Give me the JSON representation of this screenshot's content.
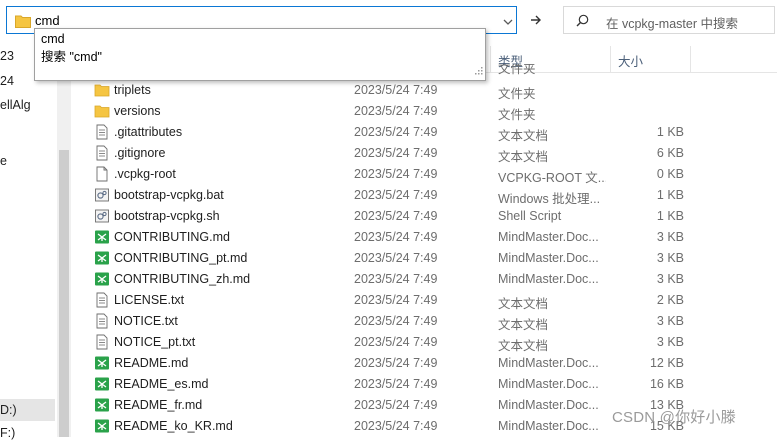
{
  "address_bar": {
    "value": "cmd"
  },
  "search_box": {
    "placeholder": "在 vcpkg-master 中搜索"
  },
  "autocomplete": {
    "items": [
      "cmd",
      "搜索 \"cmd\""
    ]
  },
  "nav_pane": {
    "items": [
      "23",
      "24",
      "ellAlg",
      "e",
      "D:)",
      "F:)"
    ]
  },
  "columns": {
    "type": "类型",
    "size": "大小"
  },
  "partial_row": {
    "type": "文件夹"
  },
  "files": [
    {
      "name": "triplets",
      "date": "2023/5/24 7:49",
      "type": "文件夹",
      "size": "",
      "icon": "folder-icon"
    },
    {
      "name": "versions",
      "date": "2023/5/24 7:49",
      "type": "文件夹",
      "size": "",
      "icon": "folder-icon"
    },
    {
      "name": ".gitattributes",
      "date": "2023/5/24 7:49",
      "type": "文本文档",
      "size": "1 KB",
      "icon": "text-file-icon"
    },
    {
      "name": ".gitignore",
      "date": "2023/5/24 7:49",
      "type": "文本文档",
      "size": "6 KB",
      "icon": "text-file-icon"
    },
    {
      "name": ".vcpkg-root",
      "date": "2023/5/24 7:49",
      "type": "VCPKG-ROOT 文...",
      "size": "0 KB",
      "icon": "blank-file-icon"
    },
    {
      "name": "bootstrap-vcpkg.bat",
      "date": "2023/5/24 7:49",
      "type": "Windows 批处理...",
      "size": "1 KB",
      "icon": "script-file-icon"
    },
    {
      "name": "bootstrap-vcpkg.sh",
      "date": "2023/5/24 7:49",
      "type": "Shell Script",
      "size": "1 KB",
      "icon": "script-file-icon"
    },
    {
      "name": "CONTRIBUTING.md",
      "date": "2023/5/24 7:49",
      "type": "MindMaster.Doc...",
      "size": "3 KB",
      "icon": "mindmaster-file-icon"
    },
    {
      "name": "CONTRIBUTING_pt.md",
      "date": "2023/5/24 7:49",
      "type": "MindMaster.Doc...",
      "size": "3 KB",
      "icon": "mindmaster-file-icon"
    },
    {
      "name": "CONTRIBUTING_zh.md",
      "date": "2023/5/24 7:49",
      "type": "MindMaster.Doc...",
      "size": "3 KB",
      "icon": "mindmaster-file-icon"
    },
    {
      "name": "LICENSE.txt",
      "date": "2023/5/24 7:49",
      "type": "文本文档",
      "size": "2 KB",
      "icon": "text-file-icon"
    },
    {
      "name": "NOTICE.txt",
      "date": "2023/5/24 7:49",
      "type": "文本文档",
      "size": "3 KB",
      "icon": "text-file-icon"
    },
    {
      "name": "NOTICE_pt.txt",
      "date": "2023/5/24 7:49",
      "type": "文本文档",
      "size": "3 KB",
      "icon": "text-file-icon"
    },
    {
      "name": "README.md",
      "date": "2023/5/24 7:49",
      "type": "MindMaster.Doc...",
      "size": "12 KB",
      "icon": "mindmaster-file-icon"
    },
    {
      "name": "README_es.md",
      "date": "2023/5/24 7:49",
      "type": "MindMaster.Doc...",
      "size": "16 KB",
      "icon": "mindmaster-file-icon"
    },
    {
      "name": "README_fr.md",
      "date": "2023/5/24 7:49",
      "type": "MindMaster.Doc...",
      "size": "13 KB",
      "icon": "mindmaster-file-icon"
    },
    {
      "name": "README_ko_KR.md",
      "date": "2023/5/24 7:49",
      "type": "MindMaster.Doc...",
      "size": "15 KB",
      "icon": "mindmaster-file-icon"
    }
  ],
  "watermark": "CSDN @你好小滕",
  "colors": {
    "accent": "#0b77d4",
    "folder": "#f5c542",
    "mindmaster": "#2aa24a"
  }
}
